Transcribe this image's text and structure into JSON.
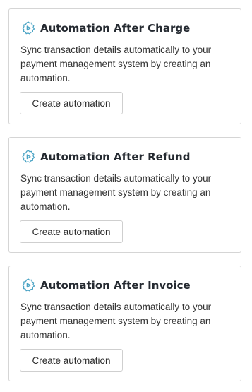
{
  "cards": [
    {
      "title": "Automation After Charge",
      "description": "Sync transaction details automatically to your payment management system by creating an automation.",
      "button_label": "Create automation",
      "icon": "automation-gear-play-icon"
    },
    {
      "title": "Automation After Refund",
      "description": "Sync transaction details automatically to your payment management system by creating an automation.",
      "button_label": "Create automation",
      "icon": "automation-gear-play-icon"
    },
    {
      "title": "Automation After Invoice",
      "description": "Sync transaction details automatically to your payment management system by creating an automation.",
      "button_label": "Create automation",
      "icon": "automation-gear-play-icon"
    }
  ],
  "colors": {
    "icon_accent": "#4aa3c4",
    "border": "#d5d5d5",
    "title": "#252a31"
  }
}
